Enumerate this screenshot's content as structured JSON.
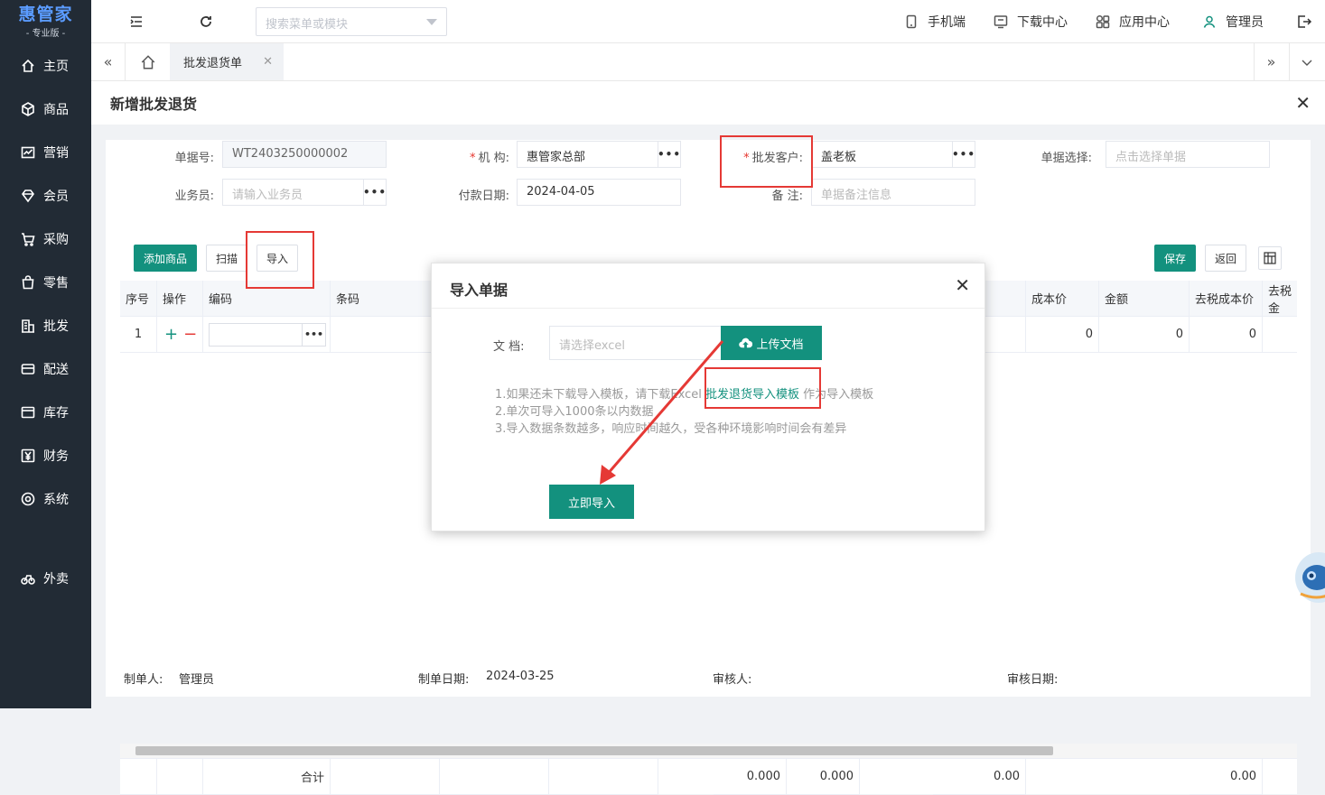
{
  "logo": {
    "title": "惠管家",
    "subtitle": "- 专业版 -"
  },
  "sidebar": {
    "items": [
      {
        "label": "主页",
        "icon": "home-icon"
      },
      {
        "label": "商品",
        "icon": "box-icon"
      },
      {
        "label": "营销",
        "icon": "chart-icon"
      },
      {
        "label": "会员",
        "icon": "diamond-icon"
      },
      {
        "label": "采购",
        "icon": "cart-icon"
      },
      {
        "label": "零售",
        "icon": "bag-icon"
      },
      {
        "label": "批发",
        "icon": "building-icon"
      },
      {
        "label": "配送",
        "icon": "truck-icon"
      },
      {
        "label": "库存",
        "icon": "inbox-icon"
      },
      {
        "label": "财务",
        "icon": "yen-icon"
      },
      {
        "label": "系统",
        "icon": "settings-icon"
      },
      {
        "label": "外卖",
        "icon": "bike-icon"
      }
    ]
  },
  "topbar": {
    "search_placeholder": "搜索菜单或模块",
    "mobile": "手机端",
    "download": "下载中心",
    "apps": "应用中心",
    "user": "管理员"
  },
  "tabs": {
    "active": "批发退货单"
  },
  "page": {
    "title": "新增批发退货"
  },
  "form": {
    "doc_no_label": "单据号:",
    "doc_no": "WT2403250000002",
    "org_label": "机 构:",
    "org": "惠管家总部",
    "customer_label": "批发客户:",
    "customer": "盖老板",
    "doc_select_label": "单据选择:",
    "doc_select_placeholder": "点击选择单据",
    "salesman_label": "业务员:",
    "salesman_placeholder": "请输入业务员",
    "pay_date_label": "付款日期:",
    "pay_date": "2024-04-05",
    "remark_label": "备 注:",
    "remark_placeholder": "单据备注信息"
  },
  "toolbar": {
    "add": "添加商品",
    "scan": "扫描",
    "import": "导入",
    "save": "保存",
    "back": "返回"
  },
  "table": {
    "headers": [
      "序号",
      "操作",
      "编码",
      "条码",
      "",
      "成本价",
      "金额",
      "去税成本价",
      "去税金"
    ],
    "row": {
      "index": "1",
      "qty": "0",
      "cost": "0",
      "amount": "0",
      "cost_ex_tax": "0"
    },
    "footer": {
      "label": "合计",
      "v1": "0.000",
      "v2": "0.000",
      "v3": "0.00",
      "v4": "0.00"
    }
  },
  "bottom": {
    "maker_label": "制单人:",
    "maker": "管理员",
    "date_label": "制单日期:",
    "date": "2024-03-25",
    "auditor_label": "审核人:",
    "audit_date_label": "审核日期:"
  },
  "modal": {
    "title": "导入单据",
    "file_label": "文 档:",
    "file_placeholder": "请选择excel",
    "upload": "上传文档",
    "hint1_pre": "1.如果还未下载导入模板，请下载Excel",
    "hint1_link": "批发退货导入模板",
    "hint1_post": "作为导入模板",
    "hint2": "2.单次可导入1000条以内数据",
    "hint3": "3.导入数据条数越多，响应时间越久，受各种环境影响时间会有差异",
    "submit": "立即导入"
  },
  "colors": {
    "accent": "#13917e",
    "sidebar": "#222b35",
    "highlight": "#e53935"
  }
}
